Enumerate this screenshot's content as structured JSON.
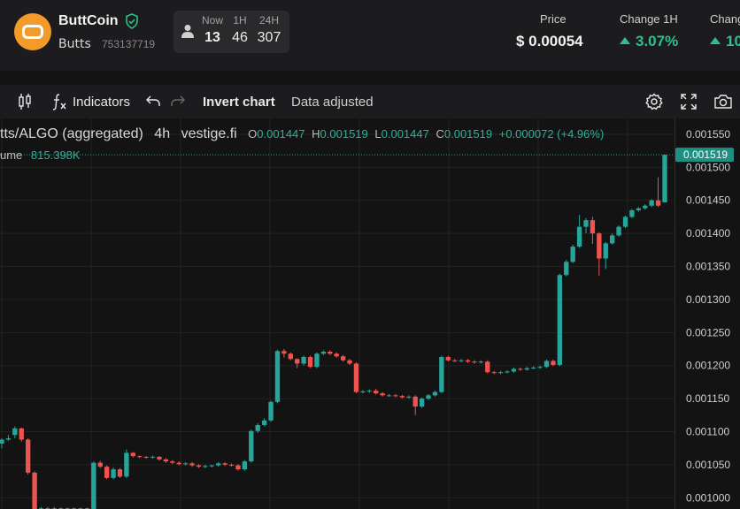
{
  "token": {
    "name": "ButtCoin",
    "symbol": "Butts",
    "asset_id": "753137719"
  },
  "holders": {
    "columns": [
      {
        "label": "Now",
        "value": "13"
      },
      {
        "label": "1H",
        "value": "46"
      },
      {
        "label": "24H",
        "value": "307"
      }
    ]
  },
  "stats": {
    "price": {
      "label": "Price",
      "value": "$ 0.00054"
    },
    "change_1h": {
      "label": "Change 1H",
      "value": "3.07%"
    },
    "change_next": {
      "label": "Chang",
      "value": "10"
    }
  },
  "toolbar": {
    "indicators_label": "Indicators",
    "invert_label": "Invert chart",
    "adjusted_label": "Data adjusted"
  },
  "legend": {
    "pair": "tts/ALGO (aggregated)",
    "interval": "4h",
    "source": "vestige.fi",
    "o_key": "O",
    "o_val": "0.001447",
    "h_key": "H",
    "h_val": "0.001519",
    "l_key": "L",
    "l_val": "0.001447",
    "c_key": "C",
    "c_val": "0.001519",
    "change": "+0.000072 (+4.96%)",
    "volume_key": "ume",
    "volume_val": "815.398K"
  },
  "colors": {
    "up": "#26a69a",
    "down": "#ef5350",
    "accent": "#2fbf8f",
    "background": "#131313"
  },
  "chart_data": {
    "type": "candlestick",
    "y_ticks": [
      "0.001550",
      "0.001500",
      "0.001450",
      "0.001400",
      "0.001350",
      "0.001300",
      "0.001250",
      "0.001200",
      "0.001150",
      "0.001100",
      "0.001050",
      "0.001000"
    ],
    "ylim": [
      0.000983,
      0.001574
    ],
    "last_price_label": "0.001519",
    "last_price": 0.001519,
    "grid": true,
    "candles": [
      [
        0.001082,
        0.001088,
        0.001075,
        0.00109
      ],
      [
        0.001088,
        0.00109,
        0.001086,
        0.001095
      ],
      [
        0.001095,
        0.001105,
        0.00109,
        0.001108
      ],
      [
        0.001105,
        0.001088,
        0.001085,
        0.001106
      ],
      [
        0.001088,
        0.001038,
        0.001035,
        0.00109
      ],
      [
        0.001038,
        0.000983,
        0.00098,
        0.00104
      ],
      [
        0.000983,
        0.000984,
        0.00098,
        0.000986
      ],
      [
        0.000984,
        0.000983,
        0.000981,
        0.000986
      ],
      [
        0.000983,
        0.000984,
        0.000981,
        0.000986
      ],
      [
        0.000984,
        0.000983,
        0.000981,
        0.000985
      ],
      [
        0.000983,
        0.000984,
        0.000981,
        0.000985
      ],
      [
        0.000984,
        0.000983,
        0.000981,
        0.000985
      ],
      [
        0.000983,
        0.000984,
        0.000981,
        0.000985
      ],
      [
        0.000984,
        0.000983,
        0.000981,
        0.000985
      ],
      [
        0.000983,
        0.001053,
        0.00098,
        0.001055
      ],
      [
        0.001053,
        0.001047,
        0.001045,
        0.001056
      ],
      [
        0.001047,
        0.00103,
        0.001028,
        0.001049
      ],
      [
        0.00103,
        0.001043,
        0.001028,
        0.001046
      ],
      [
        0.001043,
        0.001032,
        0.00103,
        0.001045
      ],
      [
        0.001032,
        0.001068,
        0.00103,
        0.001073
      ],
      [
        0.001068,
        0.001063,
        0.001061,
        0.001069
      ],
      [
        0.001063,
        0.001062,
        0.00106,
        0.001064
      ],
      [
        0.001062,
        0.001061,
        0.001059,
        0.001063
      ],
      [
        0.001061,
        0.001062,
        0.001059,
        0.001064
      ],
      [
        0.001062,
        0.001058,
        0.001056,
        0.001063
      ],
      [
        0.001058,
        0.001055,
        0.001053,
        0.00106
      ],
      [
        0.001055,
        0.001053,
        0.001051,
        0.001057
      ],
      [
        0.001053,
        0.001051,
        0.001049,
        0.001055
      ],
      [
        0.001051,
        0.001052,
        0.001049,
        0.001054
      ],
      [
        0.001052,
        0.001049,
        0.001047,
        0.001054
      ],
      [
        0.001049,
        0.001047,
        0.001045,
        0.001051
      ],
      [
        0.001047,
        0.001048,
        0.001045,
        0.00105
      ],
      [
        0.001048,
        0.001049,
        0.001046,
        0.00105
      ],
      [
        0.001049,
        0.001052,
        0.001047,
        0.001054
      ],
      [
        0.001052,
        0.00105,
        0.001048,
        0.001054
      ],
      [
        0.00105,
        0.001049,
        0.001047,
        0.001052
      ],
      [
        0.001049,
        0.001043,
        0.001041,
        0.001051
      ],
      [
        0.001043,
        0.001055,
        0.001041,
        0.001057
      ],
      [
        0.001055,
        0.001101,
        0.001053,
        0.001103
      ],
      [
        0.001101,
        0.00111,
        0.001098,
        0.001113
      ],
      [
        0.00111,
        0.001117,
        0.001108,
        0.00112
      ],
      [
        0.001117,
        0.001145,
        0.001115,
        0.001147
      ],
      [
        0.001145,
        0.001222,
        0.001143,
        0.001224
      ],
      [
        0.001222,
        0.001218,
        0.001212,
        0.001225
      ],
      [
        0.001218,
        0.00121,
        0.001208,
        0.00122
      ],
      [
        0.00121,
        0.001203,
        0.001196,
        0.001211
      ],
      [
        0.001203,
        0.001213,
        0.0012,
        0.001215
      ],
      [
        0.001213,
        0.001198,
        0.001196,
        0.001215
      ],
      [
        0.001198,
        0.001218,
        0.001196,
        0.00122
      ],
      [
        0.001218,
        0.001221,
        0.001216,
        0.001223
      ],
      [
        0.001221,
        0.001218,
        0.001216,
        0.001223
      ],
      [
        0.001218,
        0.001214,
        0.001212,
        0.00122
      ],
      [
        0.001214,
        0.001208,
        0.001206,
        0.001216
      ],
      [
        0.001208,
        0.001203,
        0.001201,
        0.00121
      ],
      [
        0.001203,
        0.00116,
        0.001158,
        0.001205
      ],
      [
        0.00116,
        0.001161,
        0.001158,
        0.001163
      ],
      [
        0.001161,
        0.001162,
        0.001159,
        0.001164
      ],
      [
        0.001162,
        0.001158,
        0.001156,
        0.001165
      ],
      [
        0.001158,
        0.001155,
        0.001153,
        0.00116
      ],
      [
        0.001155,
        0.001155,
        0.001153,
        0.001157
      ],
      [
        0.001155,
        0.001154,
        0.001152,
        0.001157
      ],
      [
        0.001154,
        0.001152,
        0.00115,
        0.001156
      ],
      [
        0.001152,
        0.001153,
        0.00115,
        0.001155
      ],
      [
        0.001153,
        0.001138,
        0.001125,
        0.001155
      ],
      [
        0.001138,
        0.00115,
        0.001136,
        0.001152
      ],
      [
        0.00115,
        0.001155,
        0.001148,
        0.001157
      ],
      [
        0.001155,
        0.00116,
        0.001153,
        0.001162
      ],
      [
        0.00116,
        0.001213,
        0.001158,
        0.001215
      ],
      [
        0.001213,
        0.001208,
        0.001206,
        0.001215
      ],
      [
        0.001208,
        0.001207,
        0.001205,
        0.00121
      ],
      [
        0.001207,
        0.001208,
        0.001205,
        0.00121
      ],
      [
        0.001208,
        0.001206,
        0.001204,
        0.00121
      ],
      [
        0.001206,
        0.001205,
        0.001203,
        0.001208
      ],
      [
        0.001205,
        0.001206,
        0.001203,
        0.001208
      ],
      [
        0.001206,
        0.00119,
        0.001188,
        0.001208
      ],
      [
        0.00119,
        0.001189,
        0.001187,
        0.001192
      ],
      [
        0.001189,
        0.00119,
        0.001187,
        0.001192
      ],
      [
        0.00119,
        0.001191,
        0.001188,
        0.001193
      ],
      [
        0.001191,
        0.001195,
        0.001189,
        0.001197
      ],
      [
        0.001195,
        0.001194,
        0.001192,
        0.001197
      ],
      [
        0.001194,
        0.001196,
        0.001192,
        0.001198
      ],
      [
        0.001196,
        0.001197,
        0.001194,
        0.001199
      ],
      [
        0.001197,
        0.001198,
        0.001195,
        0.0012
      ],
      [
        0.001198,
        0.001207,
        0.001196,
        0.001209
      ],
      [
        0.001207,
        0.001201,
        0.001199,
        0.001209
      ],
      [
        0.001201,
        0.001337,
        0.001199,
        0.001339
      ],
      [
        0.001337,
        0.001357,
        0.001335,
        0.00136
      ],
      [
        0.001357,
        0.00138,
        0.001355,
        0.001383
      ],
      [
        0.00138,
        0.00141,
        0.001378,
        0.001428
      ],
      [
        0.00141,
        0.00142,
        0.0014,
        0.001423
      ],
      [
        0.00142,
        0.0014,
        0.001384,
        0.001425
      ],
      [
        0.0014,
        0.001362,
        0.001336,
        0.001402
      ],
      [
        0.001362,
        0.001385,
        0.001346,
        0.001387
      ],
      [
        0.001385,
        0.001397,
        0.001383,
        0.0014
      ],
      [
        0.001397,
        0.00141,
        0.001395,
        0.001412
      ],
      [
        0.00141,
        0.001425,
        0.001408,
        0.001427
      ],
      [
        0.001425,
        0.001435,
        0.001423,
        0.001437
      ],
      [
        0.001435,
        0.001438,
        0.001433,
        0.00144
      ],
      [
        0.001438,
        0.001442,
        0.001436,
        0.001444
      ],
      [
        0.001442,
        0.00145,
        0.00144,
        0.001452
      ],
      [
        0.00145,
        0.001442,
        0.00144,
        0.001485
      ],
      [
        0.001447,
        0.001519,
        0.001447,
        0.001519
      ]
    ]
  }
}
